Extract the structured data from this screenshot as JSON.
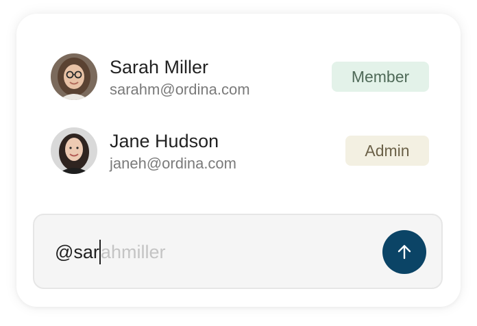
{
  "members": [
    {
      "name": "Sarah Miller",
      "email": "sarahm@ordina.com",
      "role": "Member",
      "avatar_icon": "avatar-photo-sarah"
    },
    {
      "name": "Jane Hudson",
      "email": "janeh@ordina.com",
      "role": "Admin",
      "avatar_icon": "avatar-photo-jane"
    }
  ],
  "composer": {
    "typed_text": "@sar",
    "suggestion_text": "ahmiller",
    "send_icon": "arrow-up-icon"
  },
  "colors": {
    "member_badge_bg": "#e3f2e9",
    "admin_badge_bg": "#f3f0e2",
    "send_button_bg": "#0b4466"
  }
}
